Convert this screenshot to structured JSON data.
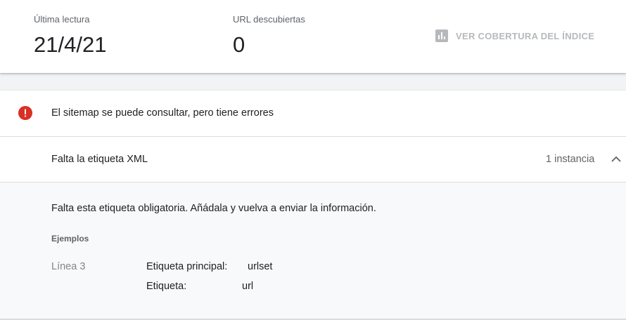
{
  "stats": {
    "last_read_label": "Última lectura",
    "last_read_value": "21/4/21",
    "discovered_label": "URL descubiertas",
    "discovered_value": "0",
    "coverage_link_label": "VER COBERTURA DEL ÍNDICE",
    "coverage_icon": "bar-chart-icon"
  },
  "status": {
    "icon": "error-icon",
    "icon_color": "#d93025",
    "text": "El sitemap se puede consultar, pero tiene errores"
  },
  "issue": {
    "title": "Falta la etiqueta XML",
    "count": "1 instancia",
    "expanded": true,
    "description": "Falta esta etiqueta obligatoria. Añádala y vuelva a enviar la información.",
    "examples_label": "Ejemplos",
    "examples": [
      {
        "line": "Línea 3",
        "parent_tag_label": "Etiqueta principal:",
        "parent_tag_value": "urlset",
        "tag_label": "Etiqueta:",
        "tag_value": "url"
      }
    ]
  }
}
